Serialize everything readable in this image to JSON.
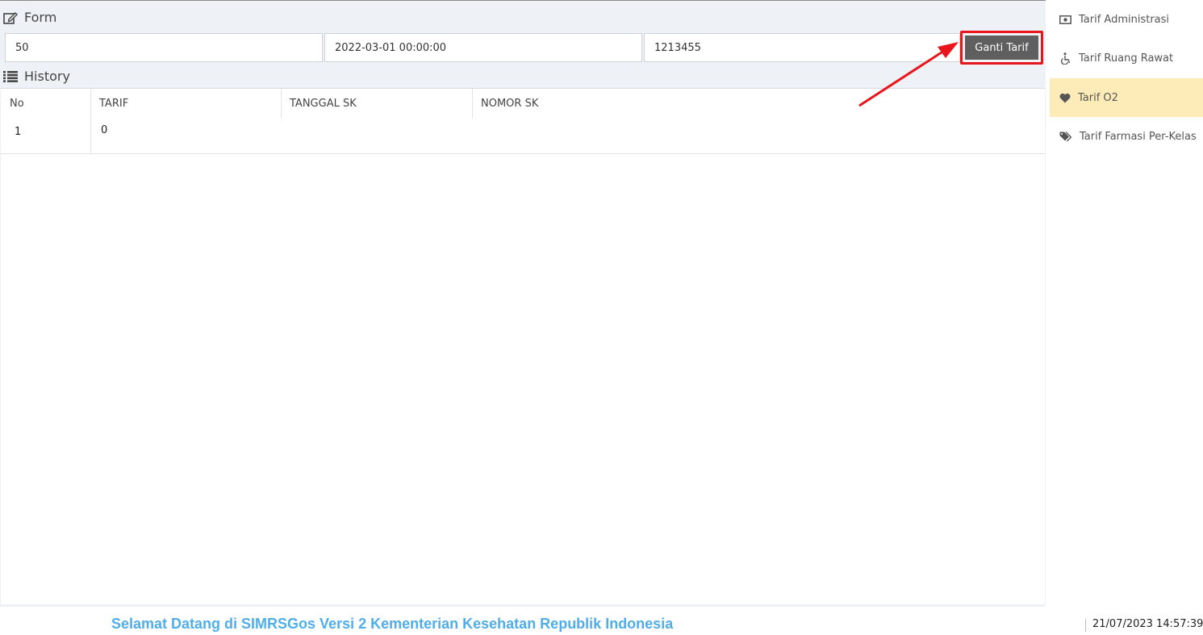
{
  "form": {
    "title": "Form",
    "tarif_value": "50",
    "tanggal_value": "2022-03-01 00:00:00",
    "nomor_value": "1213455",
    "submit_label": "Ganti Tarif"
  },
  "history": {
    "title": "History",
    "columns": [
      "No",
      "TARIF",
      "TANGGAL SK",
      "NOMOR SK"
    ],
    "rows": [
      {
        "no": "1",
        "tarif": "0",
        "tanggal": "",
        "nomor": ""
      }
    ]
  },
  "sidebar": {
    "items": [
      {
        "label": "Tarif Administrasi",
        "icon": "money-icon",
        "active": false
      },
      {
        "label": "Tarif Ruang Rawat",
        "icon": "wheelchair-icon",
        "active": false
      },
      {
        "label": "Tarif O2",
        "icon": "heart-icon",
        "active": true
      },
      {
        "label": "Tarif Farmasi Per-Kelas",
        "icon": "tags-icon",
        "active": false
      }
    ]
  },
  "footer": {
    "welcome": "Selamat Datang di SIMRSGos Versi 2 Kementerian Kesehatan Republik Indonesia",
    "datetime": "21/07/2023 14:57:39"
  },
  "colors": {
    "highlight": "#e8161b",
    "active_item": "#fdecb8",
    "welcome_text": "#4faeea",
    "button": "#5f5f5f"
  }
}
